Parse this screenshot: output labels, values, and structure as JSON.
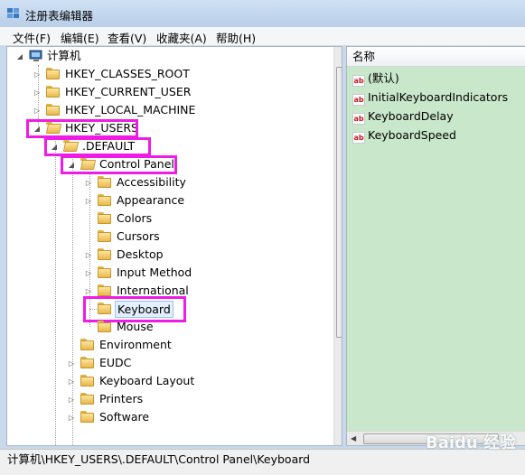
{
  "window": {
    "title": "注册表编辑器"
  },
  "menu": [
    {
      "label": "文件(F)"
    },
    {
      "label": "编辑(E)"
    },
    {
      "label": "查看(V)"
    },
    {
      "label": "收藏夹(A)"
    },
    {
      "label": "帮助(H)"
    }
  ],
  "tree": {
    "root": "计算机",
    "hives": [
      "HKEY_CLASSES_ROOT",
      "HKEY_CURRENT_USER",
      "HKEY_LOCAL_MACHINE",
      "HKEY_USERS"
    ],
    "default_key": ".DEFAULT",
    "control_panel": "Control Panel",
    "control_panel_children": [
      "Accessibility",
      "Appearance",
      "Colors",
      "Cursors",
      "Desktop",
      "Input Method",
      "International",
      "Keyboard",
      "Mouse"
    ],
    "default_children": [
      "Environment",
      "EUDC",
      "Keyboard Layout",
      "Printers",
      "Software"
    ],
    "selected": "Keyboard"
  },
  "values": {
    "column_name": "名称",
    "items": [
      "(默认)",
      "InitialKeyboardIndicators",
      "KeyboardDelay",
      "KeyboardSpeed"
    ],
    "icon": "ab-string-icon"
  },
  "status": {
    "path": "计算机\\HKEY_USERS\\.DEFAULT\\Control Panel\\Keyboard"
  },
  "watermark": {
    "text": "Baidu 经验"
  },
  "colors": {
    "highlight": "#ef1be6",
    "values_bg": "#c9e7cb",
    "selection": "#e3effc"
  }
}
